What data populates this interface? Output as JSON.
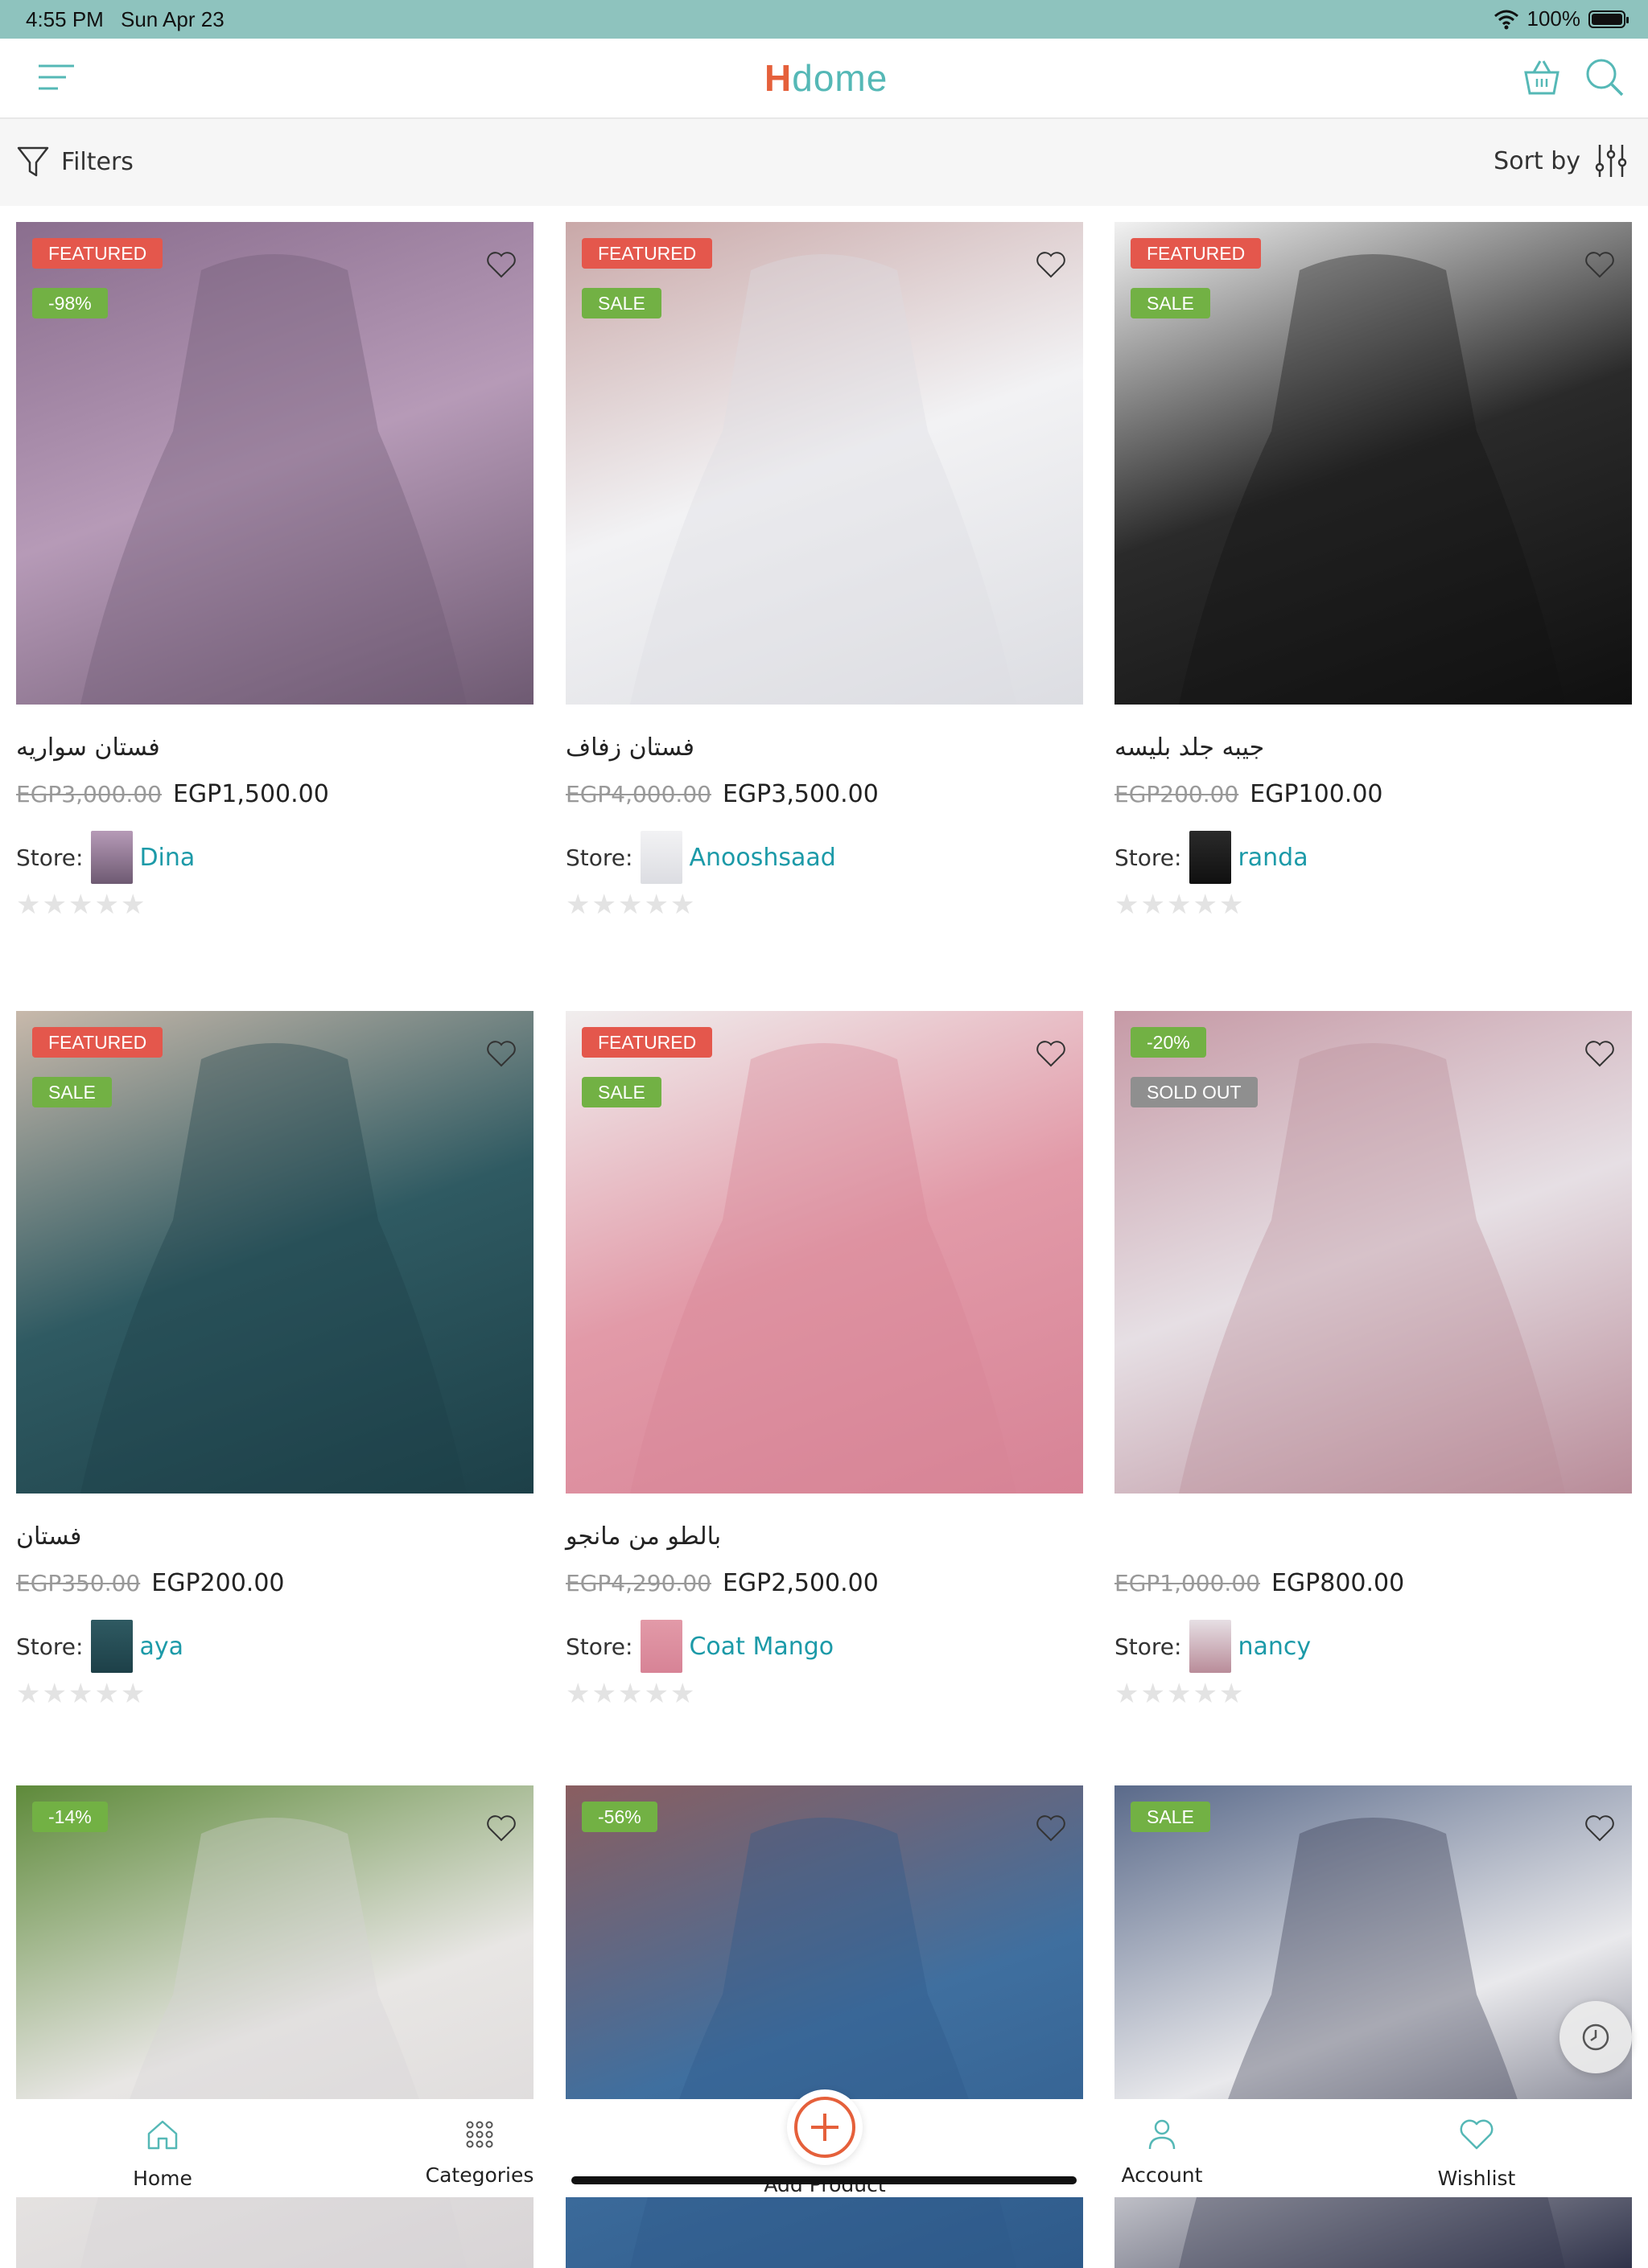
{
  "status_bar": {
    "time": "4:55 PM",
    "date": "Sun Apr 23",
    "battery": "100%"
  },
  "header": {
    "logo_text": "Hdome",
    "logo_first": "H",
    "logo_rest": "dome"
  },
  "toolbar": {
    "filters_label": "Filters",
    "sort_label": "Sort by"
  },
  "store_prefix": "Store:",
  "products": [
    {
      "badges": [
        "FEATURED",
        "-98%"
      ],
      "name": "فستان سواريه",
      "old_price": "EGP3,000.00",
      "price": "EGP1,500.00",
      "store": "Dina",
      "image_colors": [
        "#8a6e8e",
        "#b69ab7",
        "#6e5a72"
      ],
      "rating": 0
    },
    {
      "badges": [
        "FEATURED",
        "SALE"
      ],
      "name": "فستان زفاف",
      "old_price": "EGP4,000.00",
      "price": "EGP3,500.00",
      "store": "Anooshsaad",
      "image_colors": [
        "#c9a8a8",
        "#f2f2f4",
        "#dcdde2"
      ],
      "rating": 0
    },
    {
      "badges": [
        "FEATURED",
        "SALE"
      ],
      "name": "جيبه جلد بليسه",
      "old_price": "EGP200.00",
      "price": "EGP100.00",
      "store": "randa",
      "image_colors": [
        "#f2f2f2",
        "#2a2a2a",
        "#101010"
      ],
      "rating": 0
    },
    {
      "badges": [
        "FEATURED",
        "SALE"
      ],
      "name": "فستان",
      "old_price": "EGP350.00",
      "price": "EGP200.00",
      "store": "aya",
      "image_colors": [
        "#c8b9ab",
        "#2f5a62",
        "#1d4048"
      ],
      "rating": 0
    },
    {
      "badges": [
        "FEATURED",
        "SALE"
      ],
      "name": "بالطو من مانجو",
      "old_price": "EGP4,290.00",
      "price": "EGP2,500.00",
      "store": "Coat Mango",
      "image_colors": [
        "#f0eeee",
        "#e29aa8",
        "#d78396"
      ],
      "rating": 0
    },
    {
      "badges": [
        "-20%",
        "SOLD OUT"
      ],
      "name": "",
      "old_price": "EGP1,000.00",
      "price": "EGP800.00",
      "store": "nancy",
      "image_colors": [
        "#c69aa6",
        "#e6dfe4",
        "#b98c99"
      ],
      "rating": 0
    },
    {
      "badges": [
        "-14%"
      ],
      "name": "",
      "old_price": "",
      "price": "",
      "store": "",
      "image_colors": [
        "#5e8a3a",
        "#e8e6e4",
        "#d8d4d6"
      ],
      "rating": 0
    },
    {
      "badges": [
        "-56%"
      ],
      "name": "",
      "old_price": "",
      "price": "",
      "store": "",
      "image_colors": [
        "#8a5e60",
        "#3f6f9f",
        "#2e5a8a"
      ],
      "rating": 0
    },
    {
      "badges": [
        "SALE"
      ],
      "name": "",
      "old_price": "",
      "price": "",
      "store": "",
      "image_colors": [
        "#5a6a8a",
        "#e9e9ec",
        "#30334a"
      ],
      "rating": 0
    }
  ],
  "tabs": [
    {
      "label": "Home",
      "icon": "home-icon"
    },
    {
      "label": "Categories",
      "icon": "grid-icon"
    },
    {
      "label": "Add Product",
      "icon": "plus-icon"
    },
    {
      "label": "Account",
      "icon": "user-icon"
    },
    {
      "label": "Wishlist",
      "icon": "heart-icon"
    }
  ],
  "colors": {
    "accent": "#55b8b6",
    "logo_h": "#e5603b",
    "status_bar": "#8ec3be",
    "featured": "#e4574c",
    "sale": "#72b144",
    "store_link": "#1c9aa8"
  }
}
